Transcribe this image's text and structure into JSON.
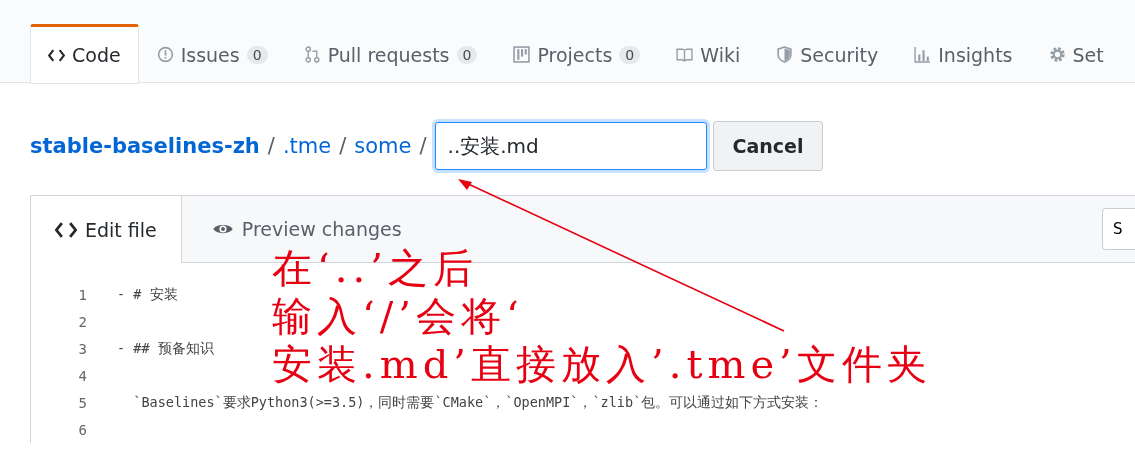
{
  "repo_tabs": [
    {
      "kind": "code",
      "label": "Code",
      "selected": true
    },
    {
      "kind": "issues",
      "label": "Issues",
      "count": "0",
      "selected": false
    },
    {
      "kind": "pulls",
      "label": "Pull requests",
      "count": "0",
      "selected": false
    },
    {
      "kind": "projects",
      "label": "Projects",
      "count": "0",
      "selected": false
    },
    {
      "kind": "wiki",
      "label": "Wiki",
      "selected": false
    },
    {
      "kind": "security",
      "label": "Security",
      "selected": false
    },
    {
      "kind": "insights",
      "label": "Insights",
      "selected": false
    },
    {
      "kind": "settings",
      "label": "Set",
      "selected": false
    }
  ],
  "breadcrumb": [
    {
      "label": "stable-baselines-zh",
      "separator": "/"
    },
    {
      "label": ".tme",
      "separator": "/"
    },
    {
      "label": "some",
      "separator": "/"
    }
  ],
  "filename_field": {
    "value": "..安装.md"
  },
  "cancel_button": "Cancel",
  "editor_tabs": [
    {
      "kind": "edit",
      "label": "Edit file",
      "selected": true
    },
    {
      "kind": "preview",
      "label": "Preview changes",
      "selected": false
    }
  ],
  "indent_select": "S",
  "code_lines": [
    {
      "number": "1",
      "text": "- # 安装"
    },
    {
      "number": "2"
    },
    {
      "number": "3",
      "text": "- ## 预备知识"
    },
    {
      "number": "4"
    },
    {
      "number": "5",
      "text": "  `Baselines`要求Python3(>=3.5)，同时需要`CMake`，`OpenMPI`，`zlib`包。可以通过如下方式安装："
    },
    {
      "number": "6"
    }
  ],
  "annotation": {
    "lines": [
      "在‘..’之后",
      "输入‘/’会将‘",
      "安装.md’直接放入’.tme’文件夹"
    ]
  }
}
